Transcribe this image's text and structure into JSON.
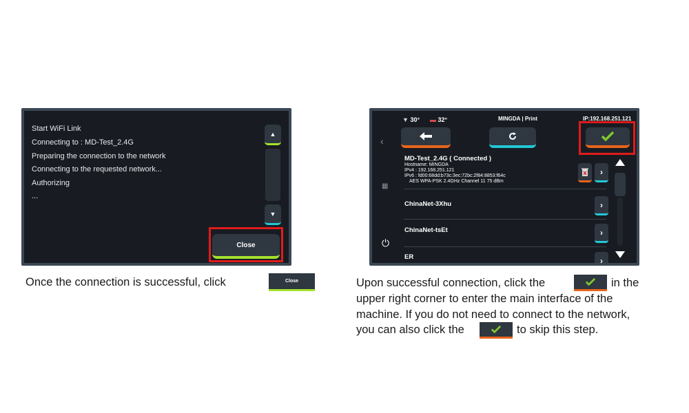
{
  "left_screen": {
    "log_lines": [
      "Start WiFi Link",
      "Connecting to : MD-Test_2.4G",
      "Preparing the connection to the network",
      "Connecting to the requested network...",
      "Authorizing",
      "..."
    ],
    "close_label": "Close"
  },
  "right_screen": {
    "nozzle_temp": "30°",
    "bed_temp": "32°",
    "title": "MINGDA | Print",
    "ip": "IP:192.168.251.121",
    "networks": [
      {
        "name": "MD-Test_2.4G ( Connected )",
        "hostname": "Hostname: MINGDA",
        "ipv4": "IPv4 : 192.168.251.121",
        "ipv6": "IPv6 : fd00:68dd:b73c:3ec:72bc:2f84:8853:f64c",
        "security": "AES WPA-PSK  2.4GHz Channel 11 75 dBm"
      },
      {
        "name": "ChinaNet-3Xhu"
      },
      {
        "name": "ChinaNet-tsEt"
      },
      {
        "name": "ER"
      }
    ]
  },
  "captions": {
    "left": "Once the connection is successful, click",
    "inline_close_label": "Close",
    "right_line1_a": "Upon successful connection, click the",
    "right_line1_b": "in the",
    "right_line2": "upper right corner to enter the main interface of the",
    "right_line3": "machine. If you do not need to connect to the network,",
    "right_line4_a": "you can also click the",
    "right_line4_b": "to skip this step."
  },
  "colors": {
    "accent_green": "#a6e22e",
    "accent_orange": "#e8641c",
    "accent_cyan": "#22c8d8",
    "highlight_red": "#e01b1b",
    "check_green": "#7ec82e"
  }
}
